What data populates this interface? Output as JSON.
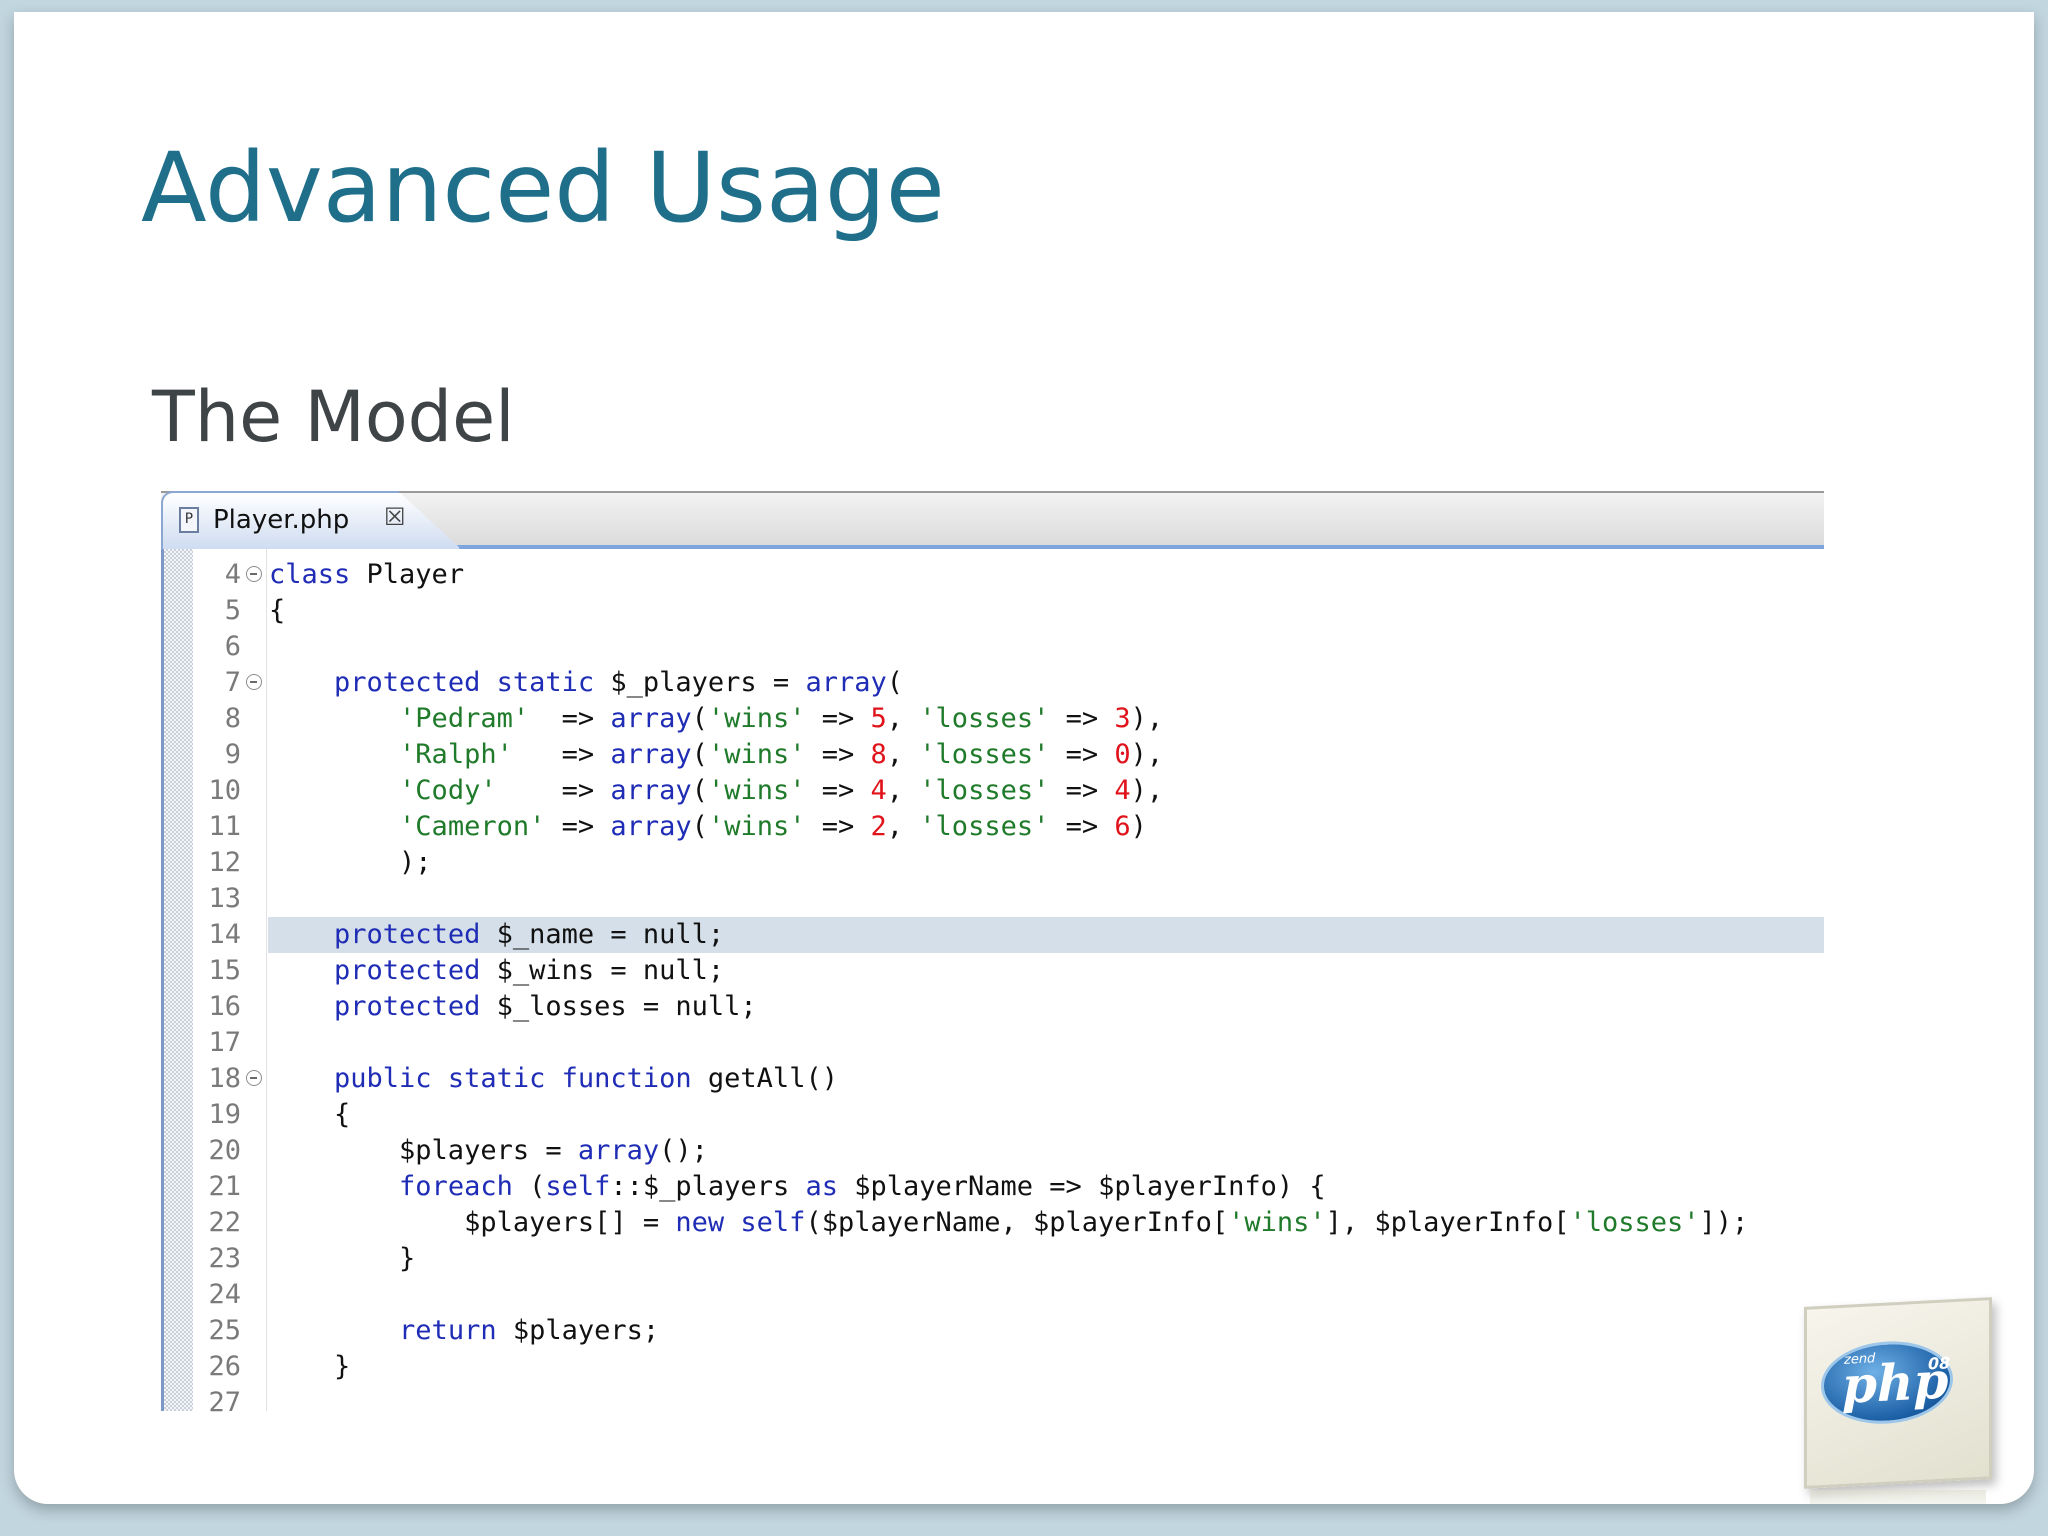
{
  "slide": {
    "title": "Advanced Usage",
    "subtitle": "The Model"
  },
  "editor": {
    "tab": {
      "file_icon_letter": "P",
      "filename": "Player.php",
      "close_glyph": "☒"
    },
    "highlighted_line": 14,
    "lines": [
      {
        "n": "4",
        "fold": true,
        "tokens": [
          {
            "t": "kw",
            "v": "class"
          },
          {
            "t": "plain",
            "v": " Player"
          }
        ]
      },
      {
        "n": "5",
        "fold": false,
        "tokens": [
          {
            "t": "plain",
            "v": "{"
          }
        ]
      },
      {
        "n": "6",
        "fold": false,
        "tokens": []
      },
      {
        "n": "7",
        "fold": true,
        "tokens": [
          {
            "t": "plain",
            "v": "    "
          },
          {
            "t": "kw",
            "v": "protected static"
          },
          {
            "t": "plain",
            "v": " $_players = "
          },
          {
            "t": "kw",
            "v": "array"
          },
          {
            "t": "plain",
            "v": "("
          }
        ]
      },
      {
        "n": "8",
        "fold": false,
        "tokens": [
          {
            "t": "plain",
            "v": "        "
          },
          {
            "t": "str",
            "v": "'Pedram'"
          },
          {
            "t": "plain",
            "v": "  => "
          },
          {
            "t": "kw",
            "v": "array"
          },
          {
            "t": "plain",
            "v": "("
          },
          {
            "t": "str",
            "v": "'wins'"
          },
          {
            "t": "plain",
            "v": " => "
          },
          {
            "t": "num",
            "v": "5"
          },
          {
            "t": "plain",
            "v": ", "
          },
          {
            "t": "str",
            "v": "'losses'"
          },
          {
            "t": "plain",
            "v": " => "
          },
          {
            "t": "num",
            "v": "3"
          },
          {
            "t": "plain",
            "v": "),"
          }
        ]
      },
      {
        "n": "9",
        "fold": false,
        "tokens": [
          {
            "t": "plain",
            "v": "        "
          },
          {
            "t": "str",
            "v": "'Ralph'"
          },
          {
            "t": "plain",
            "v": "   => "
          },
          {
            "t": "kw",
            "v": "array"
          },
          {
            "t": "plain",
            "v": "("
          },
          {
            "t": "str",
            "v": "'wins'"
          },
          {
            "t": "plain",
            "v": " => "
          },
          {
            "t": "num",
            "v": "8"
          },
          {
            "t": "plain",
            "v": ", "
          },
          {
            "t": "str",
            "v": "'losses'"
          },
          {
            "t": "plain",
            "v": " => "
          },
          {
            "t": "num",
            "v": "0"
          },
          {
            "t": "plain",
            "v": "),"
          }
        ]
      },
      {
        "n": "10",
        "fold": false,
        "tokens": [
          {
            "t": "plain",
            "v": "        "
          },
          {
            "t": "str",
            "v": "'Cody'"
          },
          {
            "t": "plain",
            "v": "    => "
          },
          {
            "t": "kw",
            "v": "array"
          },
          {
            "t": "plain",
            "v": "("
          },
          {
            "t": "str",
            "v": "'wins'"
          },
          {
            "t": "plain",
            "v": " => "
          },
          {
            "t": "num",
            "v": "4"
          },
          {
            "t": "plain",
            "v": ", "
          },
          {
            "t": "str",
            "v": "'losses'"
          },
          {
            "t": "plain",
            "v": " => "
          },
          {
            "t": "num",
            "v": "4"
          },
          {
            "t": "plain",
            "v": "),"
          }
        ]
      },
      {
        "n": "11",
        "fold": false,
        "tokens": [
          {
            "t": "plain",
            "v": "        "
          },
          {
            "t": "str",
            "v": "'Cameron'"
          },
          {
            "t": "plain",
            "v": " => "
          },
          {
            "t": "kw",
            "v": "array"
          },
          {
            "t": "plain",
            "v": "("
          },
          {
            "t": "str",
            "v": "'wins'"
          },
          {
            "t": "plain",
            "v": " => "
          },
          {
            "t": "num",
            "v": "2"
          },
          {
            "t": "plain",
            "v": ", "
          },
          {
            "t": "str",
            "v": "'losses'"
          },
          {
            "t": "plain",
            "v": " => "
          },
          {
            "t": "num",
            "v": "6"
          },
          {
            "t": "plain",
            "v": ")"
          }
        ]
      },
      {
        "n": "12",
        "fold": false,
        "tokens": [
          {
            "t": "plain",
            "v": "        );"
          }
        ]
      },
      {
        "n": "13",
        "fold": false,
        "tokens": []
      },
      {
        "n": "14",
        "fold": false,
        "tokens": [
          {
            "t": "plain",
            "v": "    "
          },
          {
            "t": "kw",
            "v": "protected"
          },
          {
            "t": "plain",
            "v": " $_name = null;"
          }
        ]
      },
      {
        "n": "15",
        "fold": false,
        "tokens": [
          {
            "t": "plain",
            "v": "    "
          },
          {
            "t": "kw",
            "v": "protected"
          },
          {
            "t": "plain",
            "v": " $_wins = null;"
          }
        ]
      },
      {
        "n": "16",
        "fold": false,
        "tokens": [
          {
            "t": "plain",
            "v": "    "
          },
          {
            "t": "kw",
            "v": "protected"
          },
          {
            "t": "plain",
            "v": " $_losses = null;"
          }
        ]
      },
      {
        "n": "17",
        "fold": false,
        "tokens": []
      },
      {
        "n": "18",
        "fold": true,
        "tokens": [
          {
            "t": "plain",
            "v": "    "
          },
          {
            "t": "kw",
            "v": "public static function"
          },
          {
            "t": "plain",
            "v": " getAll()"
          }
        ]
      },
      {
        "n": "19",
        "fold": false,
        "tokens": [
          {
            "t": "plain",
            "v": "    {"
          }
        ]
      },
      {
        "n": "20",
        "fold": false,
        "tokens": [
          {
            "t": "plain",
            "v": "        $players = "
          },
          {
            "t": "kw",
            "v": "array"
          },
          {
            "t": "plain",
            "v": "();"
          }
        ]
      },
      {
        "n": "21",
        "fold": false,
        "tokens": [
          {
            "t": "plain",
            "v": "        "
          },
          {
            "t": "kw",
            "v": "foreach"
          },
          {
            "t": "plain",
            "v": " ("
          },
          {
            "t": "kw",
            "v": "self"
          },
          {
            "t": "plain",
            "v": "::$_players "
          },
          {
            "t": "kw",
            "v": "as"
          },
          {
            "t": "plain",
            "v": " $playerName => $playerInfo) {"
          }
        ]
      },
      {
        "n": "22",
        "fold": false,
        "tokens": [
          {
            "t": "plain",
            "v": "            $players[] = "
          },
          {
            "t": "kw",
            "v": "new self"
          },
          {
            "t": "plain",
            "v": "($playerName, $playerInfo["
          },
          {
            "t": "str",
            "v": "'wins'"
          },
          {
            "t": "plain",
            "v": "], $playerInfo["
          },
          {
            "t": "str",
            "v": "'losses'"
          },
          {
            "t": "plain",
            "v": "]);"
          }
        ]
      },
      {
        "n": "23",
        "fold": false,
        "tokens": [
          {
            "t": "plain",
            "v": "        }"
          }
        ]
      },
      {
        "n": "24",
        "fold": false,
        "tokens": []
      },
      {
        "n": "25",
        "fold": false,
        "tokens": [
          {
            "t": "plain",
            "v": "        "
          },
          {
            "t": "kw",
            "v": "return"
          },
          {
            "t": "plain",
            "v": " $players;"
          }
        ]
      },
      {
        "n": "26",
        "fold": false,
        "tokens": [
          {
            "t": "plain",
            "v": "    }"
          }
        ]
      },
      {
        "n": "27",
        "fold": false,
        "tokens": []
      }
    ]
  },
  "logo": {
    "brand_small": "zend",
    "brand": "php",
    "year": "08"
  },
  "colors": {
    "title": "#1f6f8b",
    "keyword": "#1f2cb5",
    "string": "#1f7a2a",
    "number": "#e0121a",
    "highlight": "#d5dfe9"
  }
}
